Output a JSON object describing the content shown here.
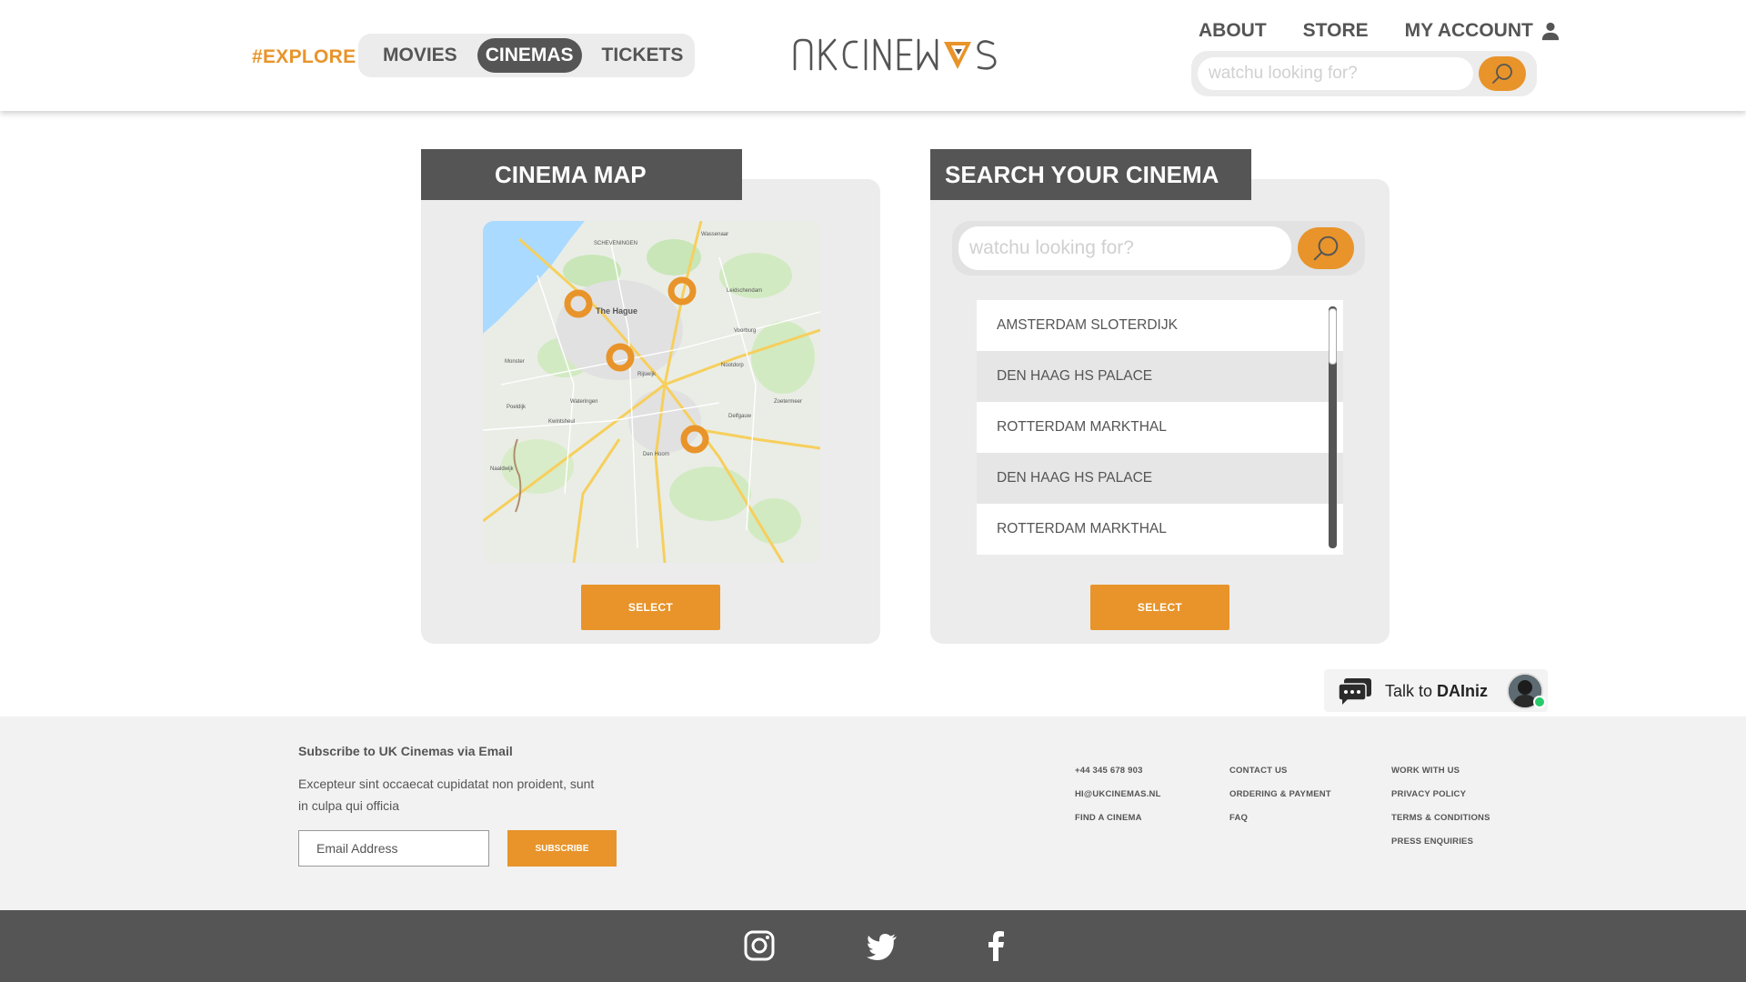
{
  "header": {
    "explore": "#EXPLORE",
    "nav": [
      "MOVIES",
      "CINEMAS",
      "TICKETS"
    ],
    "active_nav": "CINEMAS",
    "about": "ABOUT",
    "store": "STORE",
    "account": "MY ACCOUNT",
    "search_placeholder": "watchu looking for?"
  },
  "map_panel": {
    "title": "CINEMA MAP",
    "select_label": "SELECT",
    "map_city": "The Hague",
    "map_places": [
      "SCHEVENINGEN",
      "Wassenaar",
      "Leidschendam",
      "Voorburg",
      "Rijswijk",
      "Delfgauw",
      "Den Hoorn",
      "Wateringen",
      "Naaldwijk",
      "Monster",
      "Poeldijk",
      "Kwintsheul",
      "Zoetermeer",
      "Nootdorp"
    ],
    "pins": 4
  },
  "search_panel": {
    "title": "SEARCH YOUR CINEMA",
    "search_placeholder": "watchu looking for?",
    "cinemas": [
      "AMSTERDAM SLOTERDIJK",
      "DEN HAAG HS PALACE",
      "ROTTERDAM MARKTHAL",
      "DEN HAAG HS PALACE",
      "ROTTERDAM MARKTHAL"
    ],
    "select_label": "SELECT"
  },
  "chat": {
    "prefix": "Talk to ",
    "name": "DAIniz"
  },
  "footer": {
    "subscribe_title": "Subscribe to UK Cinemas via Email",
    "subscribe_desc": "Excepteur sint occaecat cupidatat non proident, sunt in culpa qui officia",
    "email_placeholder": "Email Address",
    "subscribe_label": "SUBSCRIBE",
    "col1": [
      "+44 345 678 903",
      "HI@UKCINEMAS.NL",
      "FIND A CINEMA"
    ],
    "col2": [
      "CONTACT US",
      "ORDERING & PAYMENT",
      "FAQ"
    ],
    "col3": [
      "WORK WITH US",
      "PRIVACY POLICY",
      "TERMS & CONDITIONS",
      "PRESS ENQUIRIES"
    ]
  },
  "social": [
    "instagram-icon",
    "twitter-icon",
    "facebook-icon"
  ],
  "colors": {
    "accent": "#e8942a",
    "dark": "#555555",
    "panel": "#ececec"
  }
}
